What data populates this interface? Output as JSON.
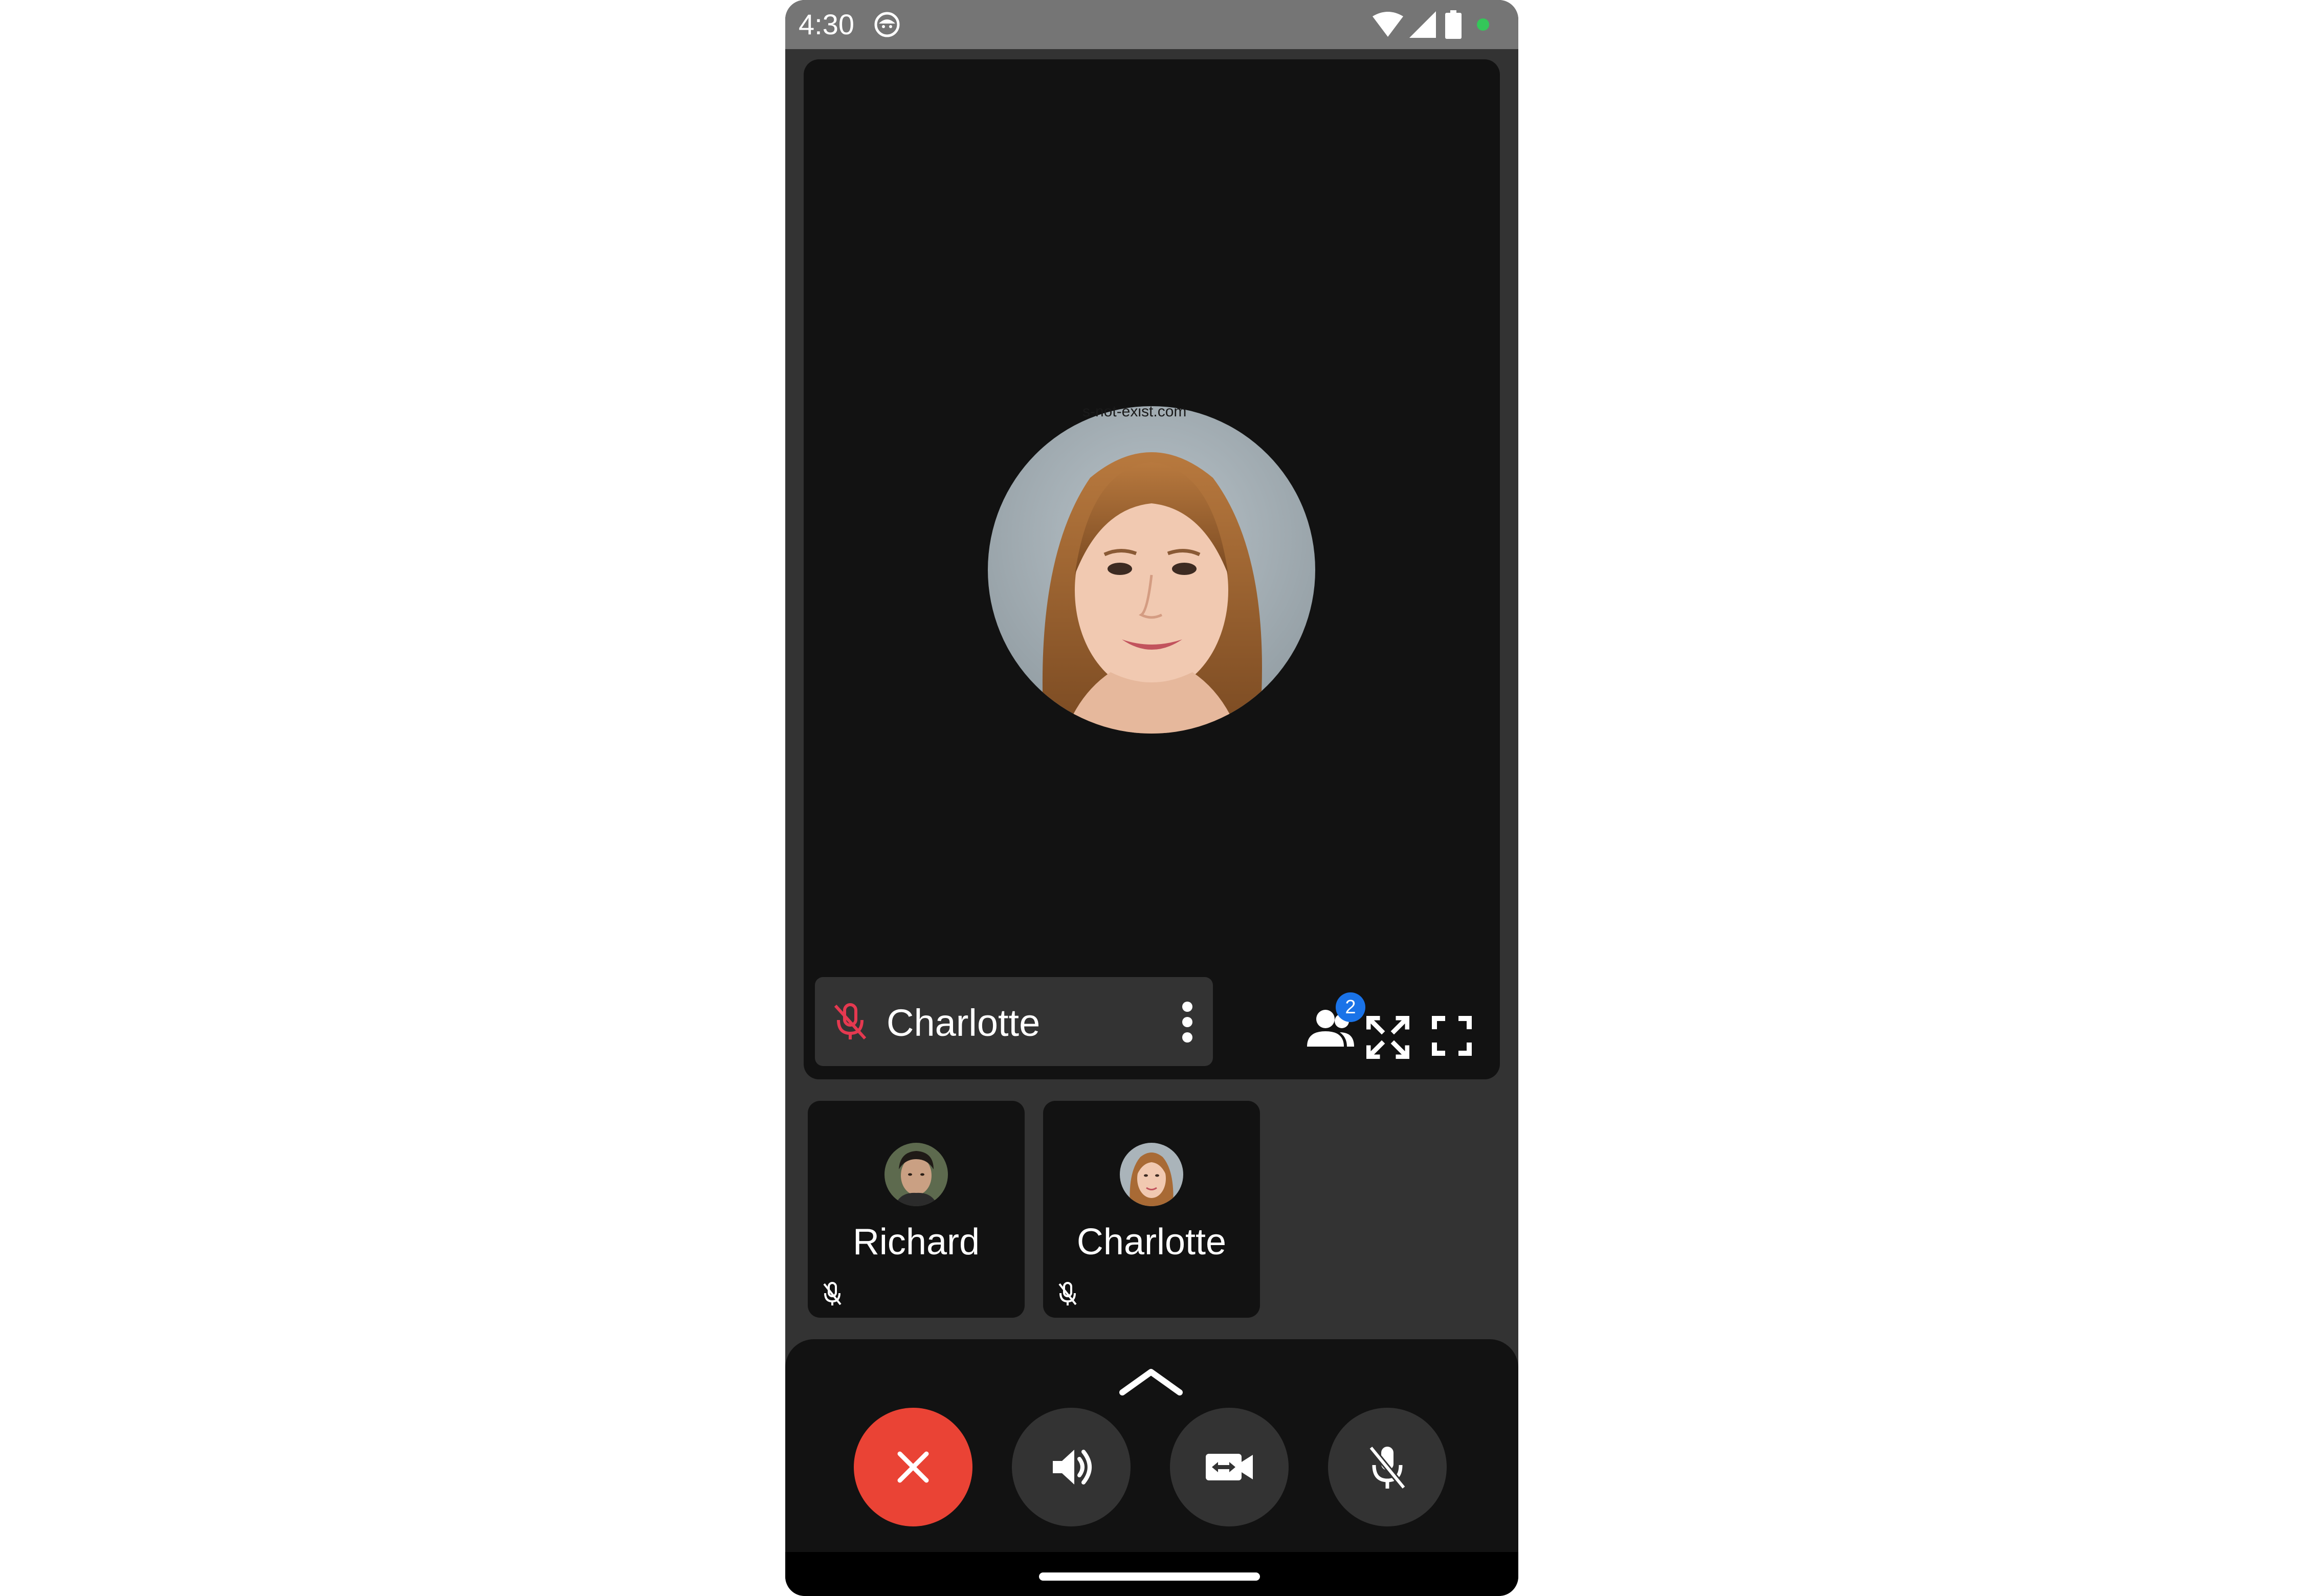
{
  "status_bar": {
    "time": "4:30",
    "app_icon": "android-face-icon",
    "right_icons": [
      "wifi-icon",
      "signal-icon",
      "battery-icon",
      "dot-indicator"
    ],
    "indicator_color": "#34c759"
  },
  "main_tile": {
    "participant_name": "Charlotte",
    "watermark": "s-not-exist.com",
    "mic_muted": true,
    "muted_color": "#e53950",
    "participants_count": "2"
  },
  "thumbnails": [
    {
      "name": "Richard"
    },
    {
      "name": "Charlotte"
    }
  ],
  "controls": {
    "buttons": [
      "end-call",
      "speaker",
      "switch-camera",
      "mute-mic"
    ],
    "end_call_color": "#ea4335"
  }
}
